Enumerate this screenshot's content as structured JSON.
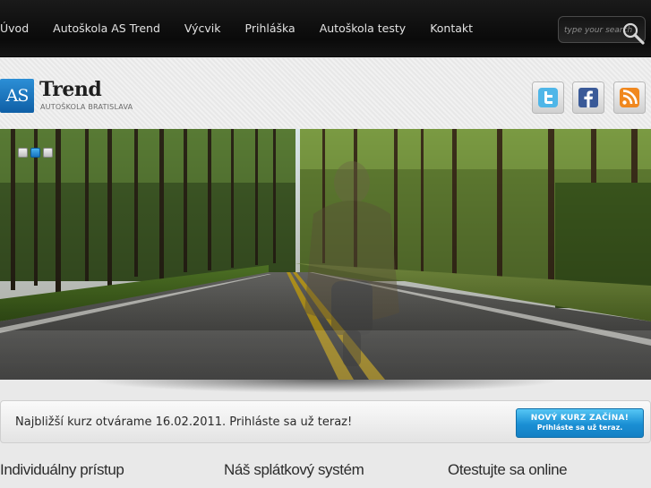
{
  "nav": {
    "items": [
      {
        "label": "Úvod"
      },
      {
        "label": "Autoškola AS Trend"
      },
      {
        "label": "Výcvik"
      },
      {
        "label": "Prihláška"
      },
      {
        "label": "Autoškola testy"
      },
      {
        "label": "Kontakt"
      }
    ],
    "search_placeholder": "type your search"
  },
  "logo": {
    "mark": "AS",
    "word": "Trend",
    "subtitle": "AUTOŠKOLA BRATISLAVA"
  },
  "social": [
    "twitter-icon",
    "facebook-icon",
    "rss-icon"
  ],
  "slider": {
    "dots": [
      false,
      true,
      false
    ]
  },
  "announcement": {
    "text": "Najbližší kurz otvárame 16.02.2011. Prihláste sa už teraz!",
    "cta_title": "NOVÝ KURZ ZAČÍNA!",
    "cta_sub": "Prihláste sa už teraz."
  },
  "columns": [
    {
      "title": "Individuálny prístup"
    },
    {
      "title": "Náš splátkový systém"
    },
    {
      "title": "Otestujte sa online"
    }
  ],
  "colors": {
    "accent": "#1a8fd4",
    "nav_bg": "#0f0f0f",
    "page_bg": "#e9e9e9"
  }
}
